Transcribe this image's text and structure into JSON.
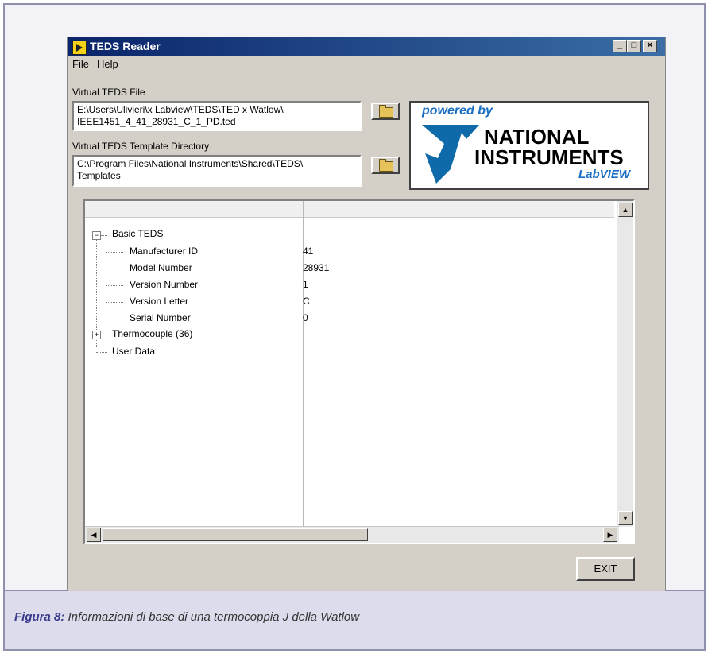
{
  "window": {
    "title": "TEDS Reader"
  },
  "menu": {
    "file": "File",
    "help": "Help"
  },
  "virtual_file": {
    "label": "Virtual TEDS File",
    "value": "E:\\Users\\Ulivieri\\x Labview\\TEDS\\TED x Watlow\\\nIEEE1451_4_41_28931_C_1_PD.ted"
  },
  "template_dir": {
    "label": "Virtual TEDS Template Directory",
    "value": "C:\\Program Files\\National Instruments\\Shared\\TEDS\\\nTemplates"
  },
  "logo": {
    "powered_by": "powered by",
    "national": "NATIONAL",
    "instruments": "INSTRUMENTS",
    "labview": "LabVIEW"
  },
  "tree": {
    "basic": "Basic TEDS",
    "rows": [
      {
        "name": "Manufacturer ID",
        "value": "41"
      },
      {
        "name": "Model Number",
        "value": "28931"
      },
      {
        "name": "Version Number",
        "value": "1"
      },
      {
        "name": "Version Letter",
        "value": "C"
      },
      {
        "name": "Serial Number",
        "value": "0"
      }
    ],
    "thermocouple": "Thermocouple (36)",
    "user_data": "User Data"
  },
  "buttons": {
    "exit": "EXIT"
  },
  "caption": {
    "figure": "Figura 8:",
    "text": " Informazioni di base di una termocoppia J della Watlow"
  }
}
